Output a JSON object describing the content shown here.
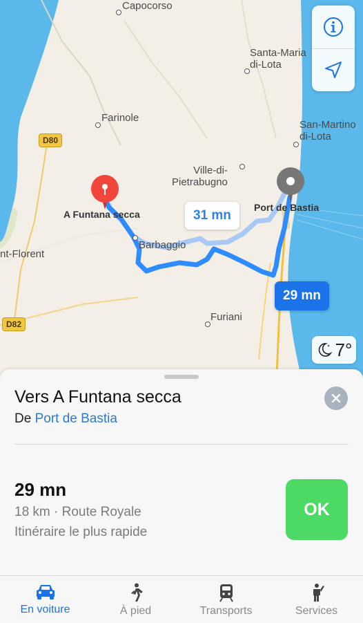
{
  "map": {
    "places": {
      "capocorso": "Capocorso",
      "santa_maria": "Santa-Maria\ndi-Lota",
      "farinole": "Farinole",
      "san_martino": "San-Martino\ndi-Lota",
      "ville_di_pietrabugno": "Ville-di-\nPietrabugno",
      "a_funtana_secca": "A Funtana secca",
      "port_de_bastia": "Port de Bastia",
      "barbaggio": "Barbaggio",
      "saint_florent": "nt-Florent",
      "furiani": "Furiani"
    },
    "road_badges": {
      "d80": "D80",
      "d82": "D82"
    },
    "route_bubbles": {
      "alt": "31 mn",
      "main": "29 mn"
    },
    "weather": {
      "temp": "7°",
      "icon": "moon-icon"
    },
    "controls": {
      "info_icon": "info-icon",
      "location_icon": "location-arrow-icon"
    },
    "colors": {
      "route_main": "#2f8cff",
      "route_alt": "#a9c9f5",
      "pin_dest": "#f0463c",
      "pin_origin": "#777777",
      "sea": "#5ab8ea"
    }
  },
  "sheet": {
    "title": "Vers A Funtana secca",
    "from_prefix": "De",
    "from_place": "Port de Bastia",
    "duration": "29 mn",
    "detail": "18 km · Route Royale",
    "note": "Itinéraire le plus rapide",
    "ok_label": "OK"
  },
  "tabs": [
    {
      "label": "En voiture",
      "icon": "car-icon",
      "active": true
    },
    {
      "label": "À pied",
      "icon": "walking-icon",
      "active": false
    },
    {
      "label": "Transports",
      "icon": "train-icon",
      "active": false
    },
    {
      "label": "Services",
      "icon": "ride-services-icon",
      "active": false
    }
  ]
}
